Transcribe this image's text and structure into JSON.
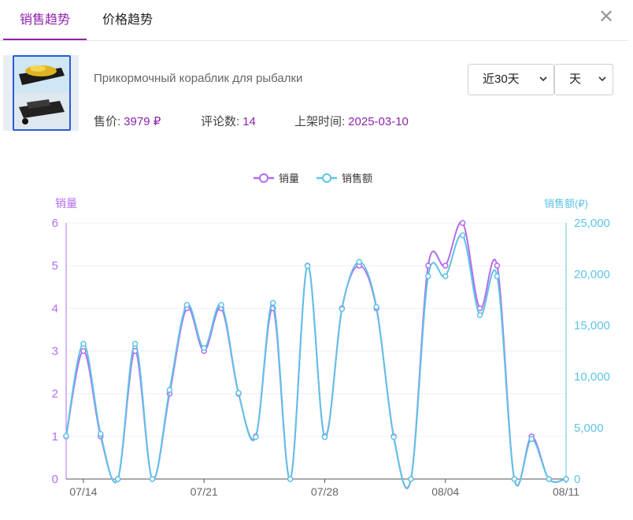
{
  "tabs": {
    "sales_trend": "销售趋势",
    "price_trend": "价格趋势"
  },
  "product": {
    "title": "Прикормочный кораблик для рыбалки",
    "price_label": "售价:",
    "price_value": "3979 ₽",
    "reviews_label": "评论数:",
    "reviews_value": "14",
    "listed_label": "上架时间:",
    "listed_value": "2025-03-10"
  },
  "filters": {
    "range": "近30天",
    "granularity": "天"
  },
  "icons": {
    "close": "close-icon",
    "dropdown": "chevron-down-icon"
  },
  "colors": {
    "accent": "#8e24aa",
    "sales": "#b36cf0",
    "revenue": "#5fc3e6"
  },
  "chart_data": {
    "type": "line",
    "legend": [
      "销量",
      "销售额"
    ],
    "legend_position": "top-center",
    "ylabel_left": "销量",
    "ylabel_right": "销售额(₽)",
    "y_left_range": [
      0,
      6
    ],
    "y_left_ticks": [
      "0",
      "1",
      "2",
      "3",
      "4",
      "5",
      "6"
    ],
    "y_right_range": [
      0,
      25000
    ],
    "y_right_ticks": [
      "0",
      "5,000",
      "10,000",
      "15,000",
      "20,000",
      "25,000"
    ],
    "x_ticks": [
      "07/14",
      "07/21",
      "07/28",
      "08/04",
      "08/11"
    ],
    "x_tick_positions": [
      1,
      8,
      15,
      22,
      29
    ],
    "x_count": 30,
    "series": [
      {
        "name": "销量",
        "axis": "left",
        "values": [
          1,
          3,
          1,
          0,
          3,
          0,
          2,
          4,
          3,
          4,
          2,
          1,
          4,
          0,
          5,
          1,
          4,
          5,
          4,
          1,
          0,
          5,
          5,
          6,
          4,
          5,
          0,
          1,
          0,
          0
        ]
      },
      {
        "name": "销售额",
        "axis": "right",
        "values": [
          4200,
          13200,
          4400,
          0,
          13200,
          0,
          8700,
          17000,
          12800,
          17000,
          8400,
          4100,
          17200,
          0,
          20800,
          4100,
          16600,
          21200,
          16800,
          4100,
          0,
          19800,
          19800,
          23800,
          16000,
          19800,
          0,
          3900,
          0,
          0
        ]
      }
    ]
  }
}
